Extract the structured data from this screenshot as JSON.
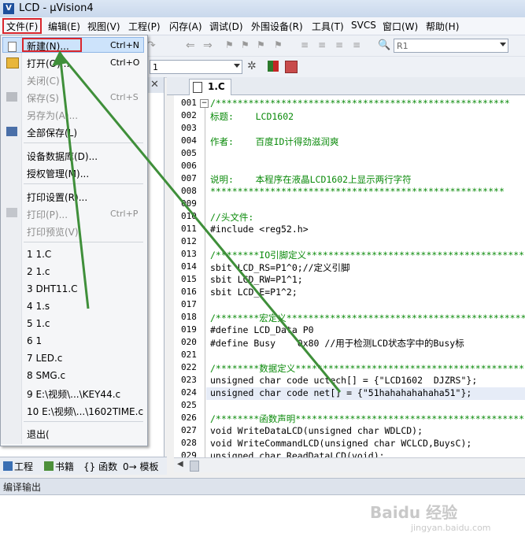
{
  "window": {
    "title": "LCD - μVision4",
    "app_icon": "uv-app-icon"
  },
  "menubar": [
    {
      "label": "文件(F)"
    },
    {
      "label": "编辑(E)"
    },
    {
      "label": "视图(V)"
    },
    {
      "label": "工程(P)"
    },
    {
      "label": "闪存(A)"
    },
    {
      "label": "调试(D)"
    },
    {
      "label": "外围设备(R)"
    },
    {
      "label": "工具(T)"
    },
    {
      "label": "SVCS"
    },
    {
      "label": "窗口(W)"
    },
    {
      "label": "帮助(H)"
    }
  ],
  "toolbar": {
    "target_combo": "R1",
    "build_combo": "1"
  },
  "file_menu": {
    "items": [
      {
        "label": "新建(N)...",
        "shortcut": "Ctrl+N",
        "disabled": false
      },
      {
        "label": "打开(O)...",
        "shortcut": "Ctrl+O",
        "disabled": false
      },
      {
        "label": "关闭(C)",
        "shortcut": "",
        "disabled": true
      },
      {
        "label": "保存(S)",
        "shortcut": "Ctrl+S",
        "disabled": true
      },
      {
        "label": "另存为(A)...",
        "shortcut": "",
        "disabled": true
      },
      {
        "label": "全部保存(L)",
        "shortcut": "",
        "disabled": false
      },
      {
        "label": "设备数据库(D)...",
        "shortcut": "",
        "disabled": false
      },
      {
        "label": "授权管理(M)...",
        "shortcut": "",
        "disabled": false
      },
      {
        "label": "打印设置(R)...",
        "shortcut": "",
        "disabled": false
      },
      {
        "label": "打印(P)...",
        "shortcut": "Ctrl+P",
        "disabled": true
      },
      {
        "label": "打印预览(V)",
        "shortcut": "",
        "disabled": true
      },
      {
        "label": "1 1.C"
      },
      {
        "label": "2 1.c"
      },
      {
        "label": "3 DHT11.C"
      },
      {
        "label": "4 1.s"
      },
      {
        "label": "5 1.c"
      },
      {
        "label": "6 1"
      },
      {
        "label": "7 LED.c"
      },
      {
        "label": "8 SMG.c"
      },
      {
        "label": "9 E:\\视频\\...\\KEY44.c"
      },
      {
        "label": "10 E:\\视频\\...\\1602TIME.c"
      },
      {
        "label": "退出("
      }
    ]
  },
  "left_tabs": [
    {
      "label": "工程"
    },
    {
      "label": "书籍"
    },
    {
      "label": "{} 函数"
    },
    {
      "label": "0→ 模板"
    }
  ],
  "editor": {
    "tab_label": "1.C",
    "line_numbers": [
      "001",
      "002",
      "003",
      "004",
      "005",
      "006",
      "007",
      "008",
      "009",
      "010",
      "011",
      "012",
      "013",
      "014",
      "015",
      "016",
      "017",
      "018",
      "019",
      "020",
      "021",
      "022",
      "023",
      "024",
      "025",
      "026",
      "027",
      "028",
      "029"
    ],
    "lines": [
      "/******************************************************",
      "标题:    LCD1602",
      "",
      "作者:    百度ID计得劲滋润爽",
      "",
      "",
      "说明:    本程序在液晶LCD1602上显示两行字符",
      "******************************************************",
      "",
      "//头文件:",
      "#include <reg52.h>",
      "",
      "/********IO引脚定义******************************************",
      "sbit LCD_RS=P1^0;//定义引脚",
      "sbit LCD_RW=P1^1;",
      "sbit LCD_E=P1^2;",
      "",
      "/********宏定义**********************************************",
      "#define LCD_Data P0",
      "#define Busy    0x80 //用于检测LCD状态字中的Busy标",
      "",
      "/********数据定义********************************************",
      "unsigned char code uctech[] = {\"LCD1602  DJZRS\"};",
      "unsigned char code net[] = {\"51hahahahahaha51\"};",
      "",
      "/********函数声明********************************************",
      "void WriteDataLCD(unsigned char WDLCD);",
      "void WriteCommandLCD(unsigned char WCLCD,BuysC);",
      "unsigned char ReadDataLCD(void);"
    ]
  },
  "output": {
    "title": "编译输出"
  },
  "watermark": {
    "text": "Baidu 经验",
    "url": "jingyan.baidu.com"
  },
  "colors": {
    "highlight_box": "#d9262c",
    "arrow": "#3f8f3a",
    "comment": "#0a8a0a",
    "keyword": "#0000cc"
  }
}
